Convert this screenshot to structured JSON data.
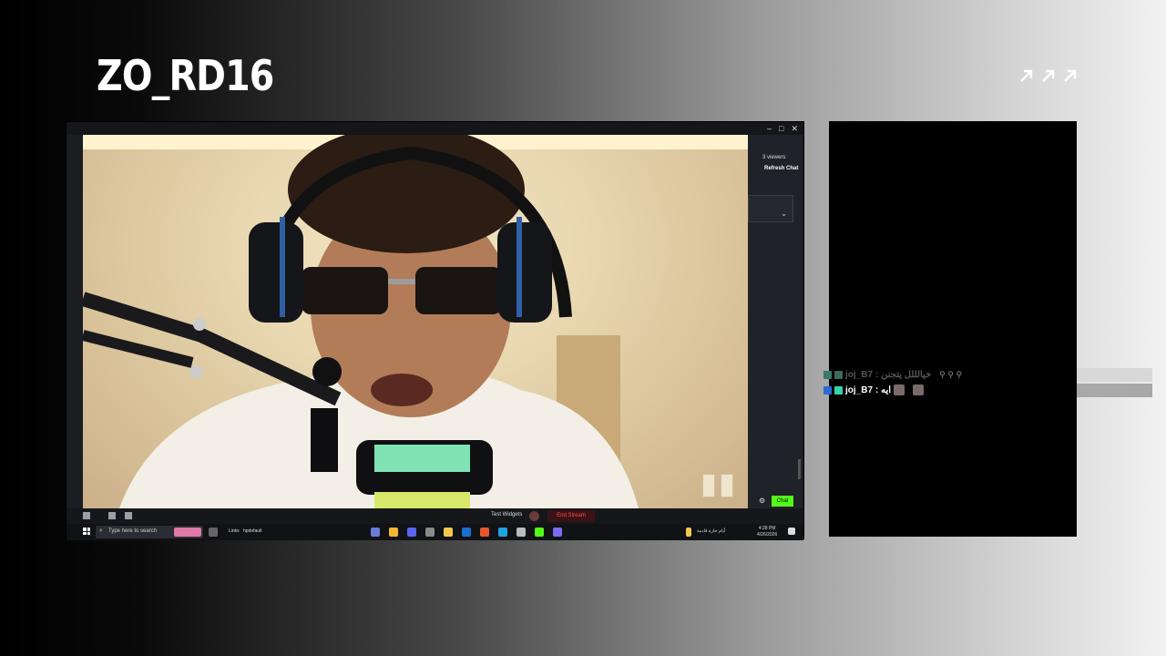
{
  "header": {
    "title": "ZO_RD16"
  },
  "screen": {
    "window_controls": [
      "–",
      "□",
      "✕"
    ],
    "side_panel": {
      "viewers": "3 viewers",
      "refresh": "Refresh Chat"
    },
    "controls": {
      "test_widgets": "Test Widgets",
      "end_stream": "End Stream",
      "chat_button": "Chat"
    },
    "taskbar": {
      "search_placeholder": "Type here to search",
      "links_label": "Links",
      "folder_label": "hpdefault",
      "weather": "أيام حارة قادمة",
      "time": "4:28 PM",
      "date": "4/26/2026"
    }
  },
  "chat": {
    "messages": [
      {
        "user": "joj_B7",
        "text": " : خيالللل يتجنن",
        "user_color": "#555555"
      },
      {
        "user": "joj_B7",
        "text": " : ايه",
        "user_color": "#ffffff"
      }
    ]
  },
  "colors": {
    "accent_green": "#53fc18",
    "end_red": "#ff4d4d"
  }
}
